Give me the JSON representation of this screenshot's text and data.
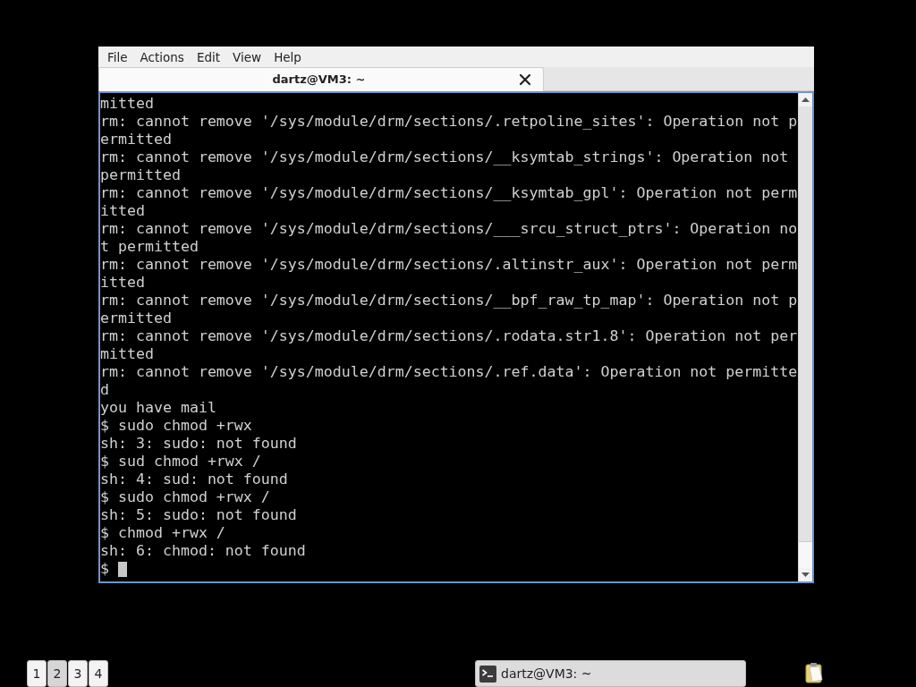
{
  "menu_bar": [
    {
      "label": "File"
    },
    {
      "label": "Actions"
    },
    {
      "label": "Edit"
    },
    {
      "label": "View"
    },
    {
      "label": "Help"
    }
  ],
  "tabs": [
    {
      "label": "dartz@VM3: ~",
      "selected": true
    }
  ],
  "terminal": {
    "lines": [
      "mitted",
      "rm: cannot remove '/sys/module/drm/sections/.retpoline_sites': Operation not p",
      "ermitted",
      "rm: cannot remove '/sys/module/drm/sections/__ksymtab_strings': Operation not",
      "permitted",
      "rm: cannot remove '/sys/module/drm/sections/__ksymtab_gpl': Operation not perm",
      "itted",
      "rm: cannot remove '/sys/module/drm/sections/___srcu_struct_ptrs': Operation no",
      "t permitted",
      "rm: cannot remove '/sys/module/drm/sections/.altinstr_aux': Operation not perm",
      "itted",
      "rm: cannot remove '/sys/module/drm/sections/__bpf_raw_tp_map': Operation not p",
      "ermitted",
      "rm: cannot remove '/sys/module/drm/sections/.rodata.str1.8': Operation not per",
      "mitted",
      "rm: cannot remove '/sys/module/drm/sections/.ref.data': Operation not permitte",
      "d",
      "you have mail",
      "$ sudo chmod +rwx",
      "sh: 3: sudo: not found",
      "$ sud chmod +rwx /",
      "sh: 4: sud: not found",
      "$ sudo chmod +rwx /",
      "sh: 5: sudo: not found",
      "$ chmod +rwx /",
      "sh: 6: chmod: not found"
    ],
    "prompt": "$",
    "cursor": true
  },
  "taskbar": {
    "workspaces": [
      {
        "label": "1",
        "selected": false
      },
      {
        "label": "2",
        "selected": true
      },
      {
        "label": "3",
        "selected": false
      },
      {
        "label": "4",
        "selected": false
      }
    ],
    "tasks": [
      {
        "label": "dartz@VM3: ~"
      }
    ]
  }
}
